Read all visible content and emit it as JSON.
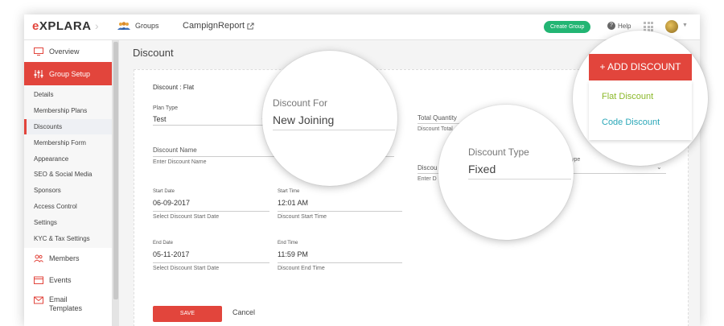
{
  "header": {
    "logo": "EXPLARA",
    "groups_label": "Groups",
    "campaign": "CampignReport",
    "create_group": "Create Group",
    "help": "Help"
  },
  "sidebar": {
    "overview": "Overview",
    "group_setup": "Group Setup",
    "sub_items": [
      "Details",
      "Membership Plans",
      "Discounts",
      "Membership Form",
      "Appearance",
      "SEO & Social Media",
      "Sponsors",
      "Access Control",
      "Settings",
      "KYC & Tax Settings"
    ],
    "members": "Members",
    "events": "Events",
    "email_templates": "Email Templates"
  },
  "page": {
    "title": "Discount",
    "discount_heading": "Discount : ",
    "discount_kind": "Flat"
  },
  "form": {
    "plan_type_label": "Plan Type",
    "plan_type_value": "Test",
    "total_quantity_label": "Total Quantity",
    "total_quantity_hint": "Discount Total",
    "discount_name_label": "Discount Name",
    "discount_name_placeholder": "Enter Discount Name",
    "discount_value_label": "Discou",
    "discount_value_hint": "Enter D",
    "discount_type_partial": "ype",
    "start_date_label": "Start Date",
    "start_date_value": "06-09-2017",
    "start_date_hint": "Select Discount Start Date",
    "start_time_label": "Start Time",
    "start_time_value": "12:01 AM",
    "start_time_hint": "Discount Start Time",
    "end_date_label": "End Date",
    "end_date_value": "05-11-2017",
    "end_date_hint": "Select Discount Start Date",
    "end_time_label": "End Time",
    "end_time_value": "11:59 PM",
    "end_time_hint": "Discount End Time",
    "save": "SAVE",
    "cancel": "Cancel"
  },
  "magnifiers": {
    "discount_for_label": "Discount For",
    "discount_for_value": "New Joining",
    "discount_type_label": "Discount Type",
    "discount_type_value": "Fixed",
    "add_discount": "+ ADD DISCOUNT",
    "menu": [
      "Flat Discount",
      "Code Discount"
    ]
  },
  "colors": {
    "brand_red": "#e2453c",
    "create_group_green": "#22b573",
    "flat_discount_green": "#8bb82a",
    "code_discount_teal": "#2aa7b8"
  }
}
